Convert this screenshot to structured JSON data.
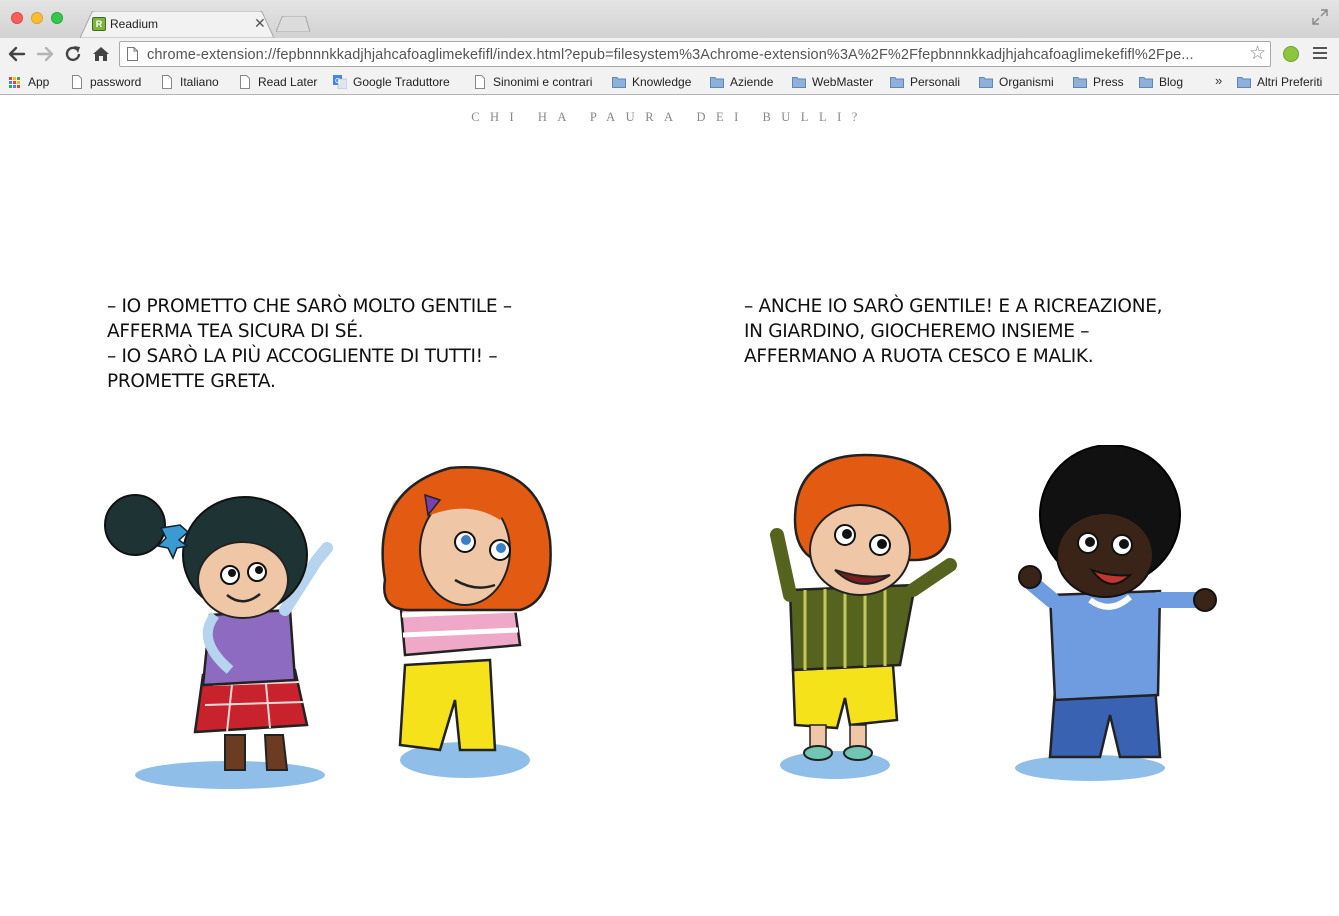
{
  "window": {
    "tab_title": "Readium",
    "tab_favicon_letter": "R"
  },
  "toolbar": {
    "url": "chrome-extension://fepbnnnkkadjhjahcafoaglimekefifl/index.html?epub=filesystem%3Achrome-extension%3A%2F%2Ffepbnnnkkadjhjahcafoaglimekefifl%2Fpe..."
  },
  "bookmarks": {
    "items": [
      {
        "label": "App",
        "icon": "apps-grid-icon"
      },
      {
        "label": "password",
        "icon": "page-icon"
      },
      {
        "label": "Italiano",
        "icon": "page-icon"
      },
      {
        "label": "Read Later",
        "icon": "page-icon"
      },
      {
        "label": "Google Traduttore",
        "icon": "google-translate-icon"
      },
      {
        "label": "Sinonimi e contrari",
        "icon": "page-icon"
      },
      {
        "label": "Knowledge",
        "icon": "folder-icon"
      },
      {
        "label": "Aziende",
        "icon": "folder-icon"
      },
      {
        "label": "WebMaster",
        "icon": "folder-icon"
      },
      {
        "label": "Personali",
        "icon": "folder-icon"
      },
      {
        "label": "Organismi",
        "icon": "folder-icon"
      },
      {
        "label": "Press",
        "icon": "folder-icon"
      },
      {
        "label": "Blog",
        "icon": "folder-icon"
      }
    ],
    "overflow": "»",
    "other": {
      "label": "Altri Preferiti",
      "icon": "folder-icon"
    }
  },
  "book": {
    "title": "CHI HA PAURA DEI BULLI?",
    "left_lines": [
      "– IO PROMETTO CHE SARÒ MOLTO GENTILE –",
      "AFFERMA TEA SICURA DI SÉ.",
      "– IO SARÒ LA PIÙ ACCOGLIENTE DI TUTTI! –",
      "PROMETTE GRETA."
    ],
    "right_lines": [
      "– ANCHE IO SARÒ GENTILE! E A RICREAZIONE,",
      "IN GIARDINO, GIOCHEREMO INSIEME –",
      "AFFERMANO A RUOTA CESCO E MALIK."
    ]
  },
  "colors": {
    "tl_close": "#fc5f57",
    "tl_min": "#fdbc2e",
    "tl_max": "#34c84a",
    "folder": "#7fa4d4",
    "ext": "#8cc63f"
  }
}
